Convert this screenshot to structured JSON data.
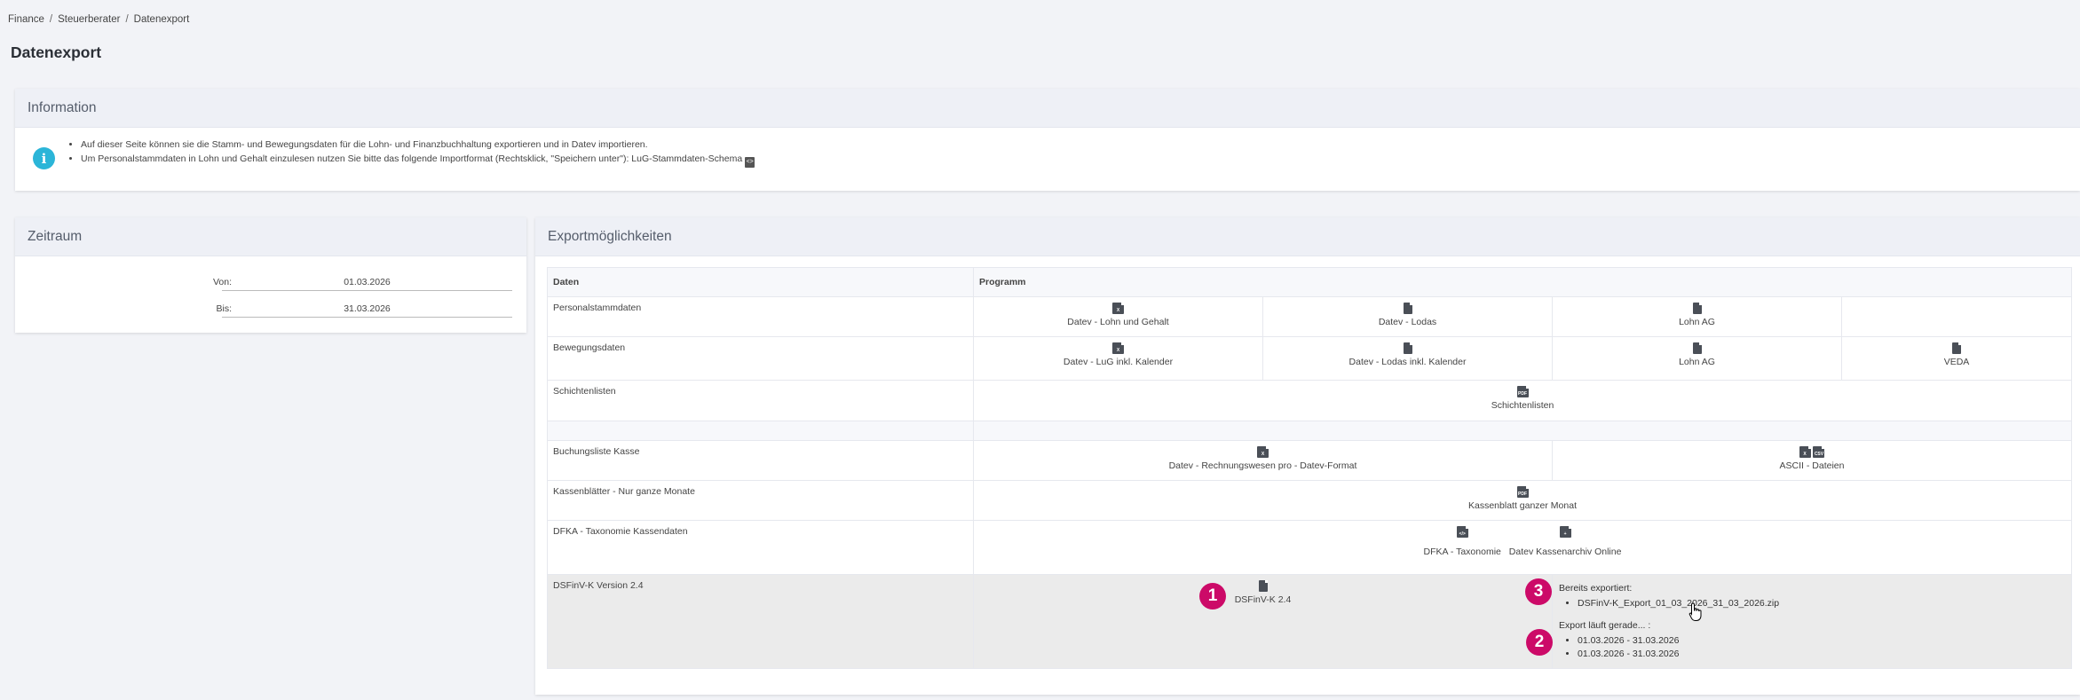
{
  "breadcrumb": [
    "Finance",
    "Steuerberater",
    "Datenexport"
  ],
  "page_title": "Datenexport",
  "information": {
    "title": "Information",
    "line1": "Auf dieser Seite können sie die Stamm- und Bewegungsdaten für die Lohn- und Finanzbuchhaltung exportieren und in Datev importieren.",
    "line2": "Um Personalstammdaten in Lohn und Gehalt einzulesen nutzen Sie bitte das folgende Importformat (Rechtsklick, \"Speichern unter\"): LuG-Stammdaten-Schema"
  },
  "zeitraum": {
    "title": "Zeitraum",
    "von_label": "Von:",
    "von_value": "01.03.2026",
    "bis_label": "Bis:",
    "bis_value": "31.03.2026"
  },
  "export": {
    "title": "Exportmöglichkeiten",
    "col_data": "Daten",
    "col_program": "Programm",
    "rows": {
      "personal": {
        "label": "Personalstammdaten",
        "p1": "Datev - Lohn und Gehalt",
        "p2": "Datev - Lodas",
        "p3": "Lohn AG"
      },
      "bewegung": {
        "label": "Bewegungsdaten",
        "p1": "Datev - LuG inkl. Kalender",
        "p2": "Datev - Lodas inkl. Kalender",
        "p3": "Lohn AG",
        "p4": "VEDA"
      },
      "schicht": {
        "label": "Schichtenlisten",
        "p1": "Schichtenlisten"
      },
      "buchung": {
        "label": "Buchungsliste Kasse",
        "p1": "Datev - Rechnungswesen pro - Datev-Format",
        "p2": "ASCII - Dateien"
      },
      "kassenblatt": {
        "label": "Kassenblätter - Nur ganze Monate",
        "p1": "Kassenblatt ganzer Monat"
      },
      "dfka": {
        "label": "DFKA - Taxonomie Kassendaten",
        "p1": "DFKA - Taxonomie",
        "p2": "Datev Kassenarchiv Online"
      },
      "dsfinv": {
        "label": "DSFinV-K Version 2.4",
        "p1": "DSFinV-K 2.4",
        "exported_label": "Bereits exportiert:",
        "exported_file": "DSFinV-K_Export_01_03_2026_31_03_2026.zip",
        "running_label": "Export läuft gerade... :",
        "running_1": "01.03.2026 - 31.03.2026",
        "running_2": "01.03.2026 - 31.03.2026"
      }
    }
  },
  "badges": {
    "b1": "1",
    "b2": "2",
    "b3": "3"
  },
  "colors": {
    "badge": "#cc0a68",
    "info_icon": "#2bb5d8",
    "header_bg": "#eef0f6"
  }
}
